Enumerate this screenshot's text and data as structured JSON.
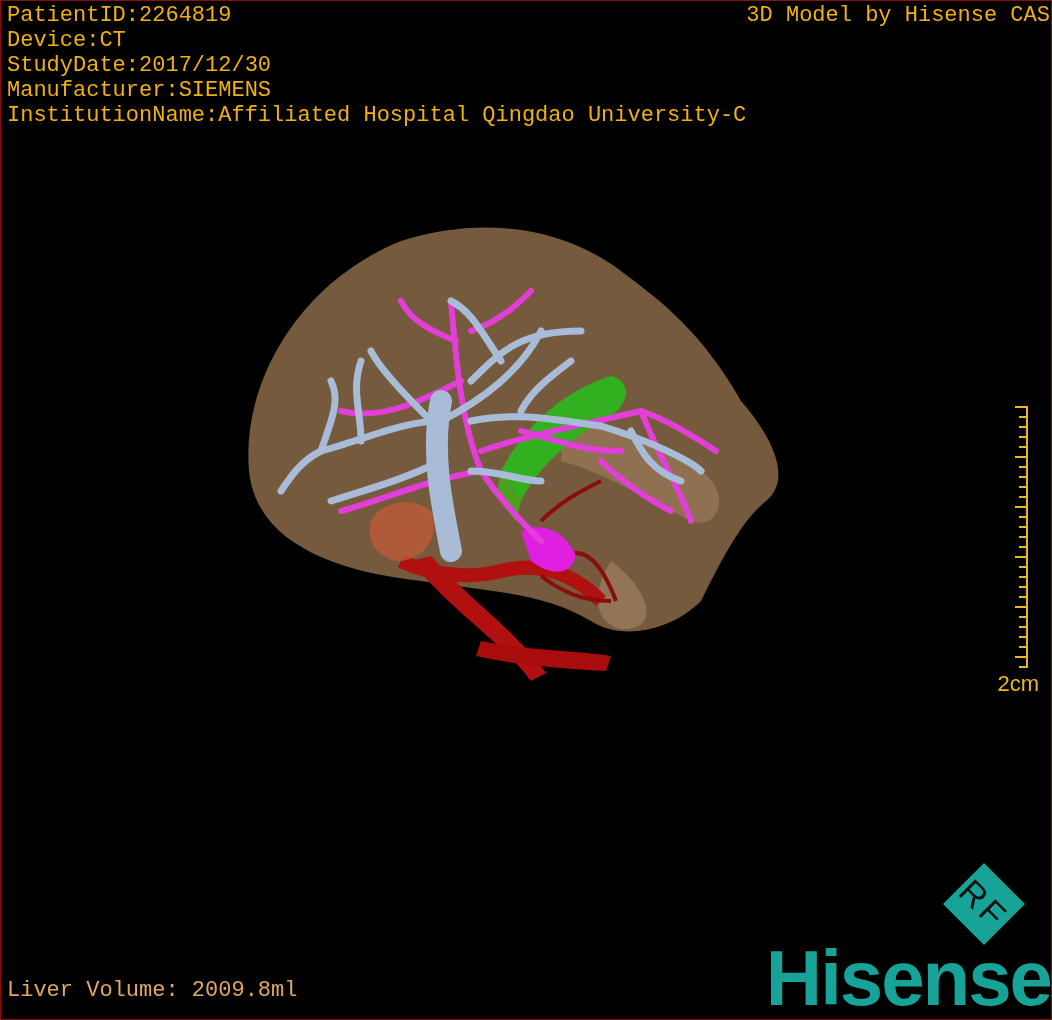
{
  "info_lines": [
    "PatientID:2264819",
    "Device:CT",
    "StudyDate:2017/12/30",
    "Manufacturer:SIEMENS",
    "InstitutionName:Affiliated Hospital Qingdao University-C"
  ],
  "model_credit": "3D Model by Hisense CAS",
  "scale_bar": {
    "label": "2cm"
  },
  "liver_volume": "Liver Volume: 2009.8ml",
  "logo": {
    "badge": "RF",
    "wordmark": "Hisense"
  }
}
